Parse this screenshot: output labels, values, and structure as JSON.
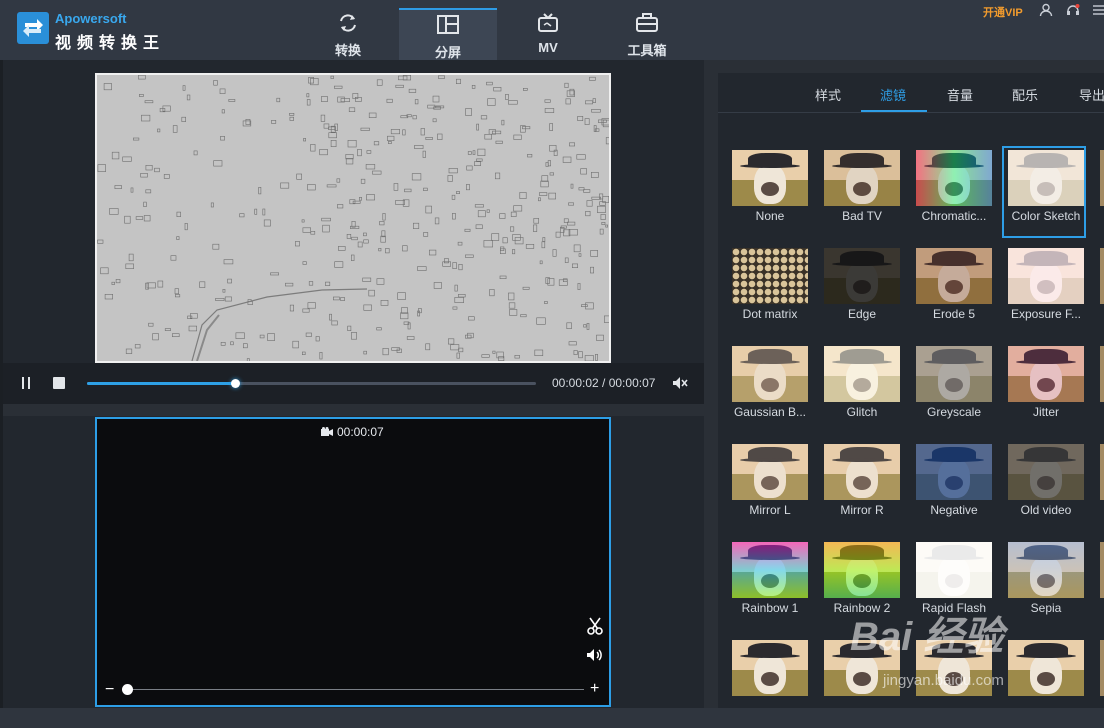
{
  "app": {
    "brand_en": "Apowersoft",
    "brand_cn": "视频转换王",
    "vip_label": "开通VIP",
    "accent_color": "#2e9ee6"
  },
  "nav": {
    "tabs": [
      {
        "label": "转换",
        "icon": "refresh-icon"
      },
      {
        "label": "分屏",
        "icon": "split-screen-icon",
        "active": true
      },
      {
        "label": "MV",
        "icon": "tv-icon"
      },
      {
        "label": "工具箱",
        "icon": "toolbox-icon"
      }
    ]
  },
  "player": {
    "time_readout": "00:00:02 / 00:00:07",
    "progress": 0.33,
    "controls": [
      "pause-icon",
      "stop-icon",
      "mute-icon"
    ]
  },
  "editor": {
    "duration": "00:00:07",
    "zoom_level": 0.0
  },
  "right_panel": {
    "tabs": [
      {
        "label": "样式"
      },
      {
        "label": "滤镜",
        "active": true
      },
      {
        "label": "音量"
      },
      {
        "label": "配乐"
      },
      {
        "label": "导出"
      }
    ],
    "filters": [
      {
        "label": "None"
      },
      {
        "label": "Bad TV"
      },
      {
        "label": "Chromatic..."
      },
      {
        "label": "Color Sketch",
        "selected": true
      },
      {
        "label": "Dot matrix"
      },
      {
        "label": "Edge"
      },
      {
        "label": "Erode 5"
      },
      {
        "label": "Exposure F..."
      },
      {
        "label": "Gaussian B..."
      },
      {
        "label": "Glitch"
      },
      {
        "label": "Greyscale"
      },
      {
        "label": "Jitter"
      },
      {
        "label": "Mirror L"
      },
      {
        "label": "Mirror R"
      },
      {
        "label": "Negative"
      },
      {
        "label": "Old video"
      },
      {
        "label": "Rainbow 1"
      },
      {
        "label": "Rainbow 2"
      },
      {
        "label": "Rapid Flash"
      },
      {
        "label": "Sepia"
      }
    ]
  },
  "watermark": {
    "text": "Bai 经验",
    "sub": "jingyan.baidu.com"
  }
}
